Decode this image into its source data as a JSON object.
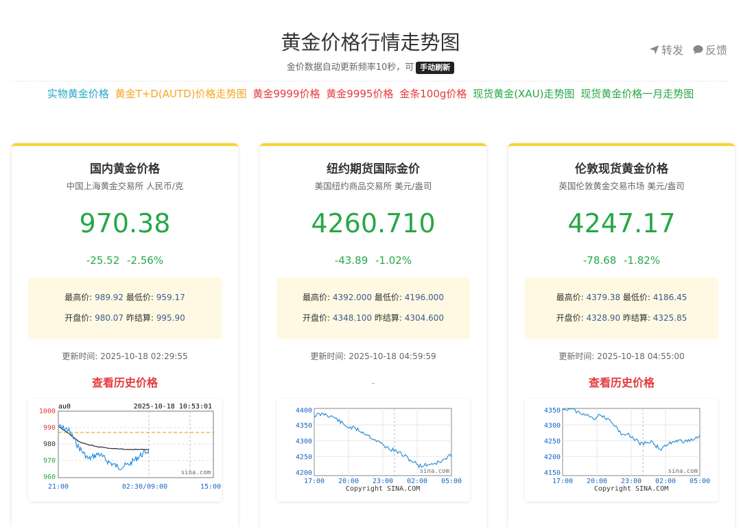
{
  "topbar": {
    "share_label": "转发",
    "feedback_label": "反馈"
  },
  "header": {
    "title": "黄金价格行情走势图",
    "subtitle": "金价数据自动更新频率10秒，可",
    "refresh_label": "手动刷新"
  },
  "nav": [
    {
      "label": "实物黄金价格",
      "color": "#2aa7c8"
    },
    {
      "label": "黄金T+D(AUTD)价格走势图",
      "color": "#f5a623"
    },
    {
      "label": "黄金9999价格",
      "color": "#e4393c"
    },
    {
      "label": "黄金9995价格",
      "color": "#e4393c"
    },
    {
      "label": "金条100g价格",
      "color": "#e4393c"
    },
    {
      "label": "现货黄金(XAU)走势图",
      "color": "#27a745"
    },
    {
      "label": "现货黄金价格一月走势图",
      "color": "#27a745"
    }
  ],
  "labels": {
    "high": "最高价:",
    "low": "最低价:",
    "open": "开盘价:",
    "prev": "昨结算:",
    "updated_prefix": "更新时间: "
  },
  "cards": [
    {
      "title": "国内黄金价格",
      "subtitle": "中国上海黄金交易所 人民币/克",
      "price": "970.38",
      "change": "-25.52",
      "change_pct": "-2.56%",
      "high": "989.92",
      "low": "959.17",
      "open": "980.07",
      "prev": "995.90",
      "updated": "2025-10-18 02:29:55",
      "history_label": "查看历史价格",
      "chart": {
        "symbol": "au0",
        "timestamp": "2025-10-18 10:53:01",
        "y_ticks": [
          "1000",
          "990",
          "980",
          "970",
          "960"
        ],
        "x_ticks": [
          "21:00",
          "02:30/09:00",
          "15:00"
        ],
        "watermark": "sina.com"
      }
    },
    {
      "title": "纽约期货国际金价",
      "subtitle": "美国纽约商品交易所 美元/盎司",
      "price": "4260.710",
      "change": "-43.89",
      "change_pct": "-1.02%",
      "high": "4392.000",
      "low": "4196.000",
      "open": "4348.100",
      "prev": "4304.600",
      "updated": "2025-10-18 04:59:59",
      "history_label": "-",
      "chart": {
        "y_ticks": [
          "4400",
          "4350",
          "4300",
          "4250",
          "4200"
        ],
        "x_ticks": [
          "17:00",
          "20:00",
          "23:00",
          "02:00",
          "05:00"
        ],
        "watermark": "sina.com",
        "copyright": "Copyright  SINA.COM"
      }
    },
    {
      "title": "伦敦现货黄金价格",
      "subtitle": "英国伦敦黄金交易市场 美元/盎司",
      "price": "4247.17",
      "change": "-78.68",
      "change_pct": "-1.82%",
      "high": "4379.38",
      "low": "4186.45",
      "open": "4328.90",
      "prev": "4325.85",
      "updated": "2025-10-18 04:55:00",
      "history_label": "查看历史价格",
      "chart": {
        "y_ticks": [
          "4350",
          "4300",
          "4250",
          "4200",
          "4150"
        ],
        "x_ticks": [
          "17:00",
          "20:00",
          "23:00",
          "02:00",
          "05:00"
        ],
        "watermark": "sina.com",
        "copyright": "Copyright  SINA.COM"
      }
    }
  ]
}
